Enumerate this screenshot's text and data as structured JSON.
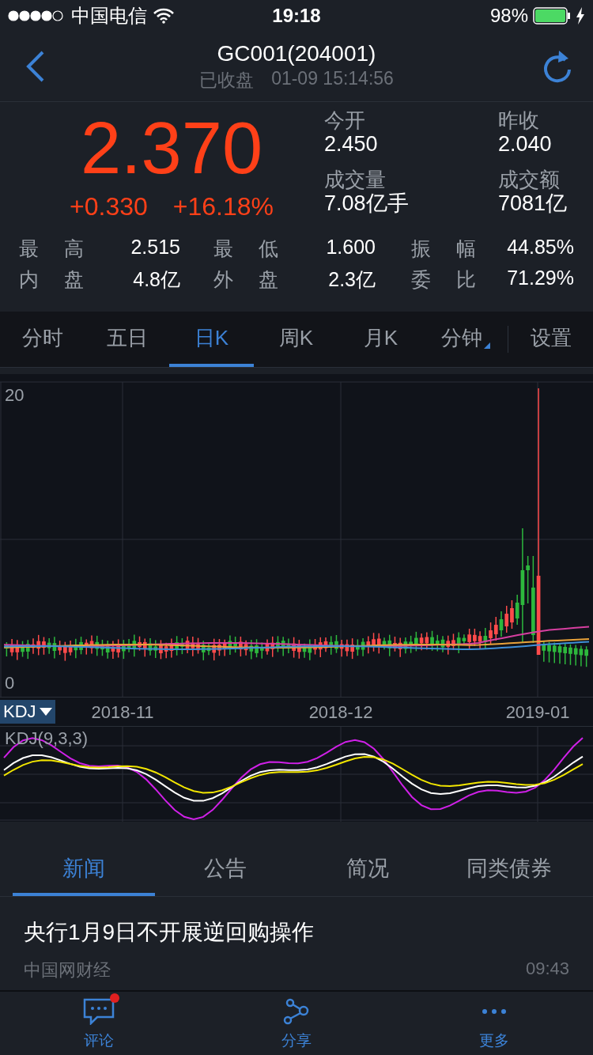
{
  "status_bar": {
    "carrier": "中国电信",
    "time": "19:18",
    "battery": "98%"
  },
  "header": {
    "title": "GC001(204001)",
    "market_state": "已收盘",
    "timestamp": "01-09 15:14:56"
  },
  "quote": {
    "price": "2.370",
    "change": "+0.330",
    "change_pct": "+16.18%",
    "side": [
      {
        "label": "今开",
        "value": "2.450"
      },
      {
        "label": "昨收",
        "value": "2.040"
      },
      {
        "label": "成交量",
        "value": "7.08亿手"
      },
      {
        "label": "成交额",
        "value": "7081亿"
      }
    ],
    "stats": [
      {
        "label": "最 高",
        "value": "2.515"
      },
      {
        "label": "最 低",
        "value": "1.600"
      },
      {
        "label": "振 幅",
        "value": "44.85%"
      },
      {
        "label": "内 盘",
        "value": "4.8亿"
      },
      {
        "label": "外 盘",
        "value": "2.3亿"
      },
      {
        "label": "委 比",
        "value": "71.29%"
      }
    ]
  },
  "chart_tabs": [
    {
      "label": "分时",
      "selected": false,
      "kind": "plain"
    },
    {
      "label": "五日",
      "selected": false,
      "kind": "plain"
    },
    {
      "label": "日K",
      "selected": true,
      "kind": "plain"
    },
    {
      "label": "周K",
      "selected": false,
      "kind": "plain"
    },
    {
      "label": "月K",
      "selected": false,
      "kind": "plain"
    },
    {
      "label": "分钟",
      "selected": false,
      "kind": "dropdown"
    }
  ],
  "settings": "设置",
  "kline": {
    "y_labels": [
      "20",
      "0"
    ],
    "x_labels": [
      "2018-11",
      "2018-12",
      "2019-01"
    ],
    "indicator": "KDJ",
    "indicator_params": "KDJ(9,3,3)"
  },
  "info_tabs": [
    {
      "label": "新闻",
      "selected": true
    },
    {
      "label": "公告",
      "selected": false
    },
    {
      "label": "简况",
      "selected": false
    },
    {
      "label": "同类债券",
      "selected": false
    }
  ],
  "news": [
    {
      "title": "央行1月9日不开展逆回购操作",
      "source": "中国网财经",
      "time": "09:43"
    }
  ],
  "bottom_nav": [
    {
      "label": "评论",
      "kind": "comment",
      "unread": true
    },
    {
      "label": "分享",
      "kind": "share",
      "unread": false
    },
    {
      "label": "更多",
      "kind": "more",
      "unread": false
    }
  ]
}
